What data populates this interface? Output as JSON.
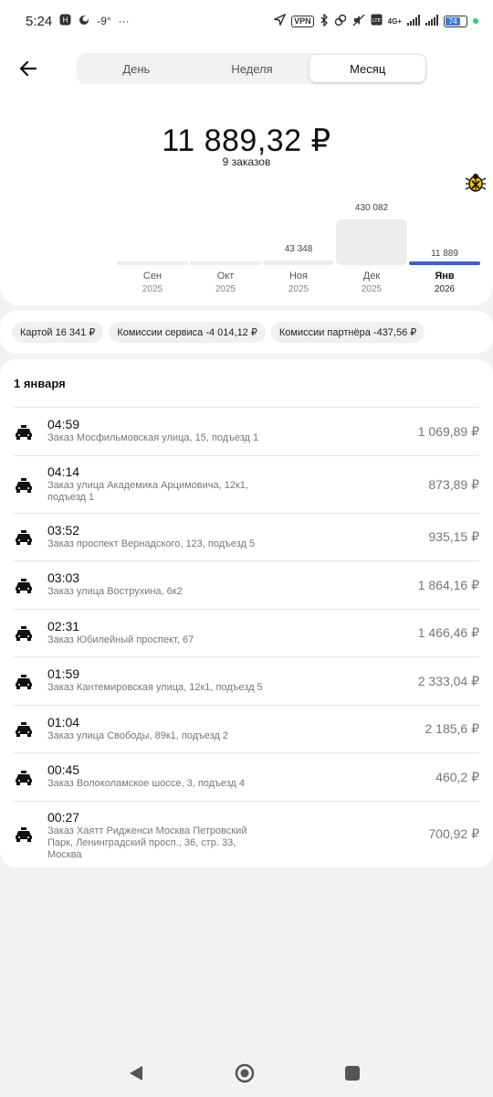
{
  "status_bar": {
    "time": "5:24",
    "temperature": "-9°",
    "more": "···",
    "vpn": "VPN",
    "network": "4G+",
    "battery": "74"
  },
  "period_tabs": [
    {
      "label": "День",
      "active": false
    },
    {
      "label": "Неделя",
      "active": false
    },
    {
      "label": "Месяц",
      "active": true
    }
  ],
  "summary": {
    "total": "11 889,32 ₽",
    "orders_count": "9 заказов"
  },
  "months": [
    {
      "label": "Сен",
      "year": "2025",
      "value_label": "",
      "value": 0,
      "active": false
    },
    {
      "label": "Окт",
      "year": "2025",
      "value_label": "",
      "value": 0,
      "active": false
    },
    {
      "label": "Ноя",
      "year": "2025",
      "value_label": "43 348",
      "value": 43348,
      "active": false
    },
    {
      "label": "Дек",
      "year": "2025",
      "value_label": "430 082",
      "value": 430082,
      "active": false
    },
    {
      "label": "Янв",
      "year": "2026",
      "value_label": "11 889",
      "value": 11889,
      "active": true
    }
  ],
  "chips": [
    "Картой 16 341 ₽",
    "Комиссии сервиса -4 014,12 ₽",
    "Комиссии партнёра -437,56 ₽"
  ],
  "day": {
    "label": "1 января",
    "orders": [
      {
        "time": "04:59",
        "address": "Заказ Мосфильмовская улица, 15, подъезд 1",
        "amount": "1 069,89 ₽"
      },
      {
        "time": "04:14",
        "address": "Заказ улица Академика Арцимовича, 12к1, подъезд 1",
        "amount": "873,89 ₽"
      },
      {
        "time": "03:52",
        "address": "Заказ проспект Вернадского, 123, подъезд 5",
        "amount": "935,15 ₽"
      },
      {
        "time": "03:03",
        "address": "Заказ улица Вострухина, 6к2",
        "amount": "1 864,16 ₽"
      },
      {
        "time": "02:31",
        "address": "Заказ Юбилейный проспект, 67",
        "amount": "1 466,46 ₽"
      },
      {
        "time": "01:59",
        "address": "Заказ Кантемировская улица, 12к1, подъезд 5",
        "amount": "2 333,04 ₽"
      },
      {
        "time": "01:04",
        "address": "Заказ улица Свободы, 89к1, подъезд 2",
        "amount": "2 185,6 ₽"
      },
      {
        "time": "00:45",
        "address": "Заказ Волоколамское шоссе, 3, подъезд 4",
        "amount": "460,2 ₽"
      },
      {
        "time": "00:27",
        "address": "Заказ Хаятт Ридженси Москва Петровский Парк, Ленинградский просп., 36, стр. 33, Москва",
        "amount": "700,92 ₽"
      }
    ]
  },
  "colors": {
    "accent_bar": "#3d5fd0",
    "inactive_bar": "#ececec",
    "background": "#f2f2f2"
  }
}
